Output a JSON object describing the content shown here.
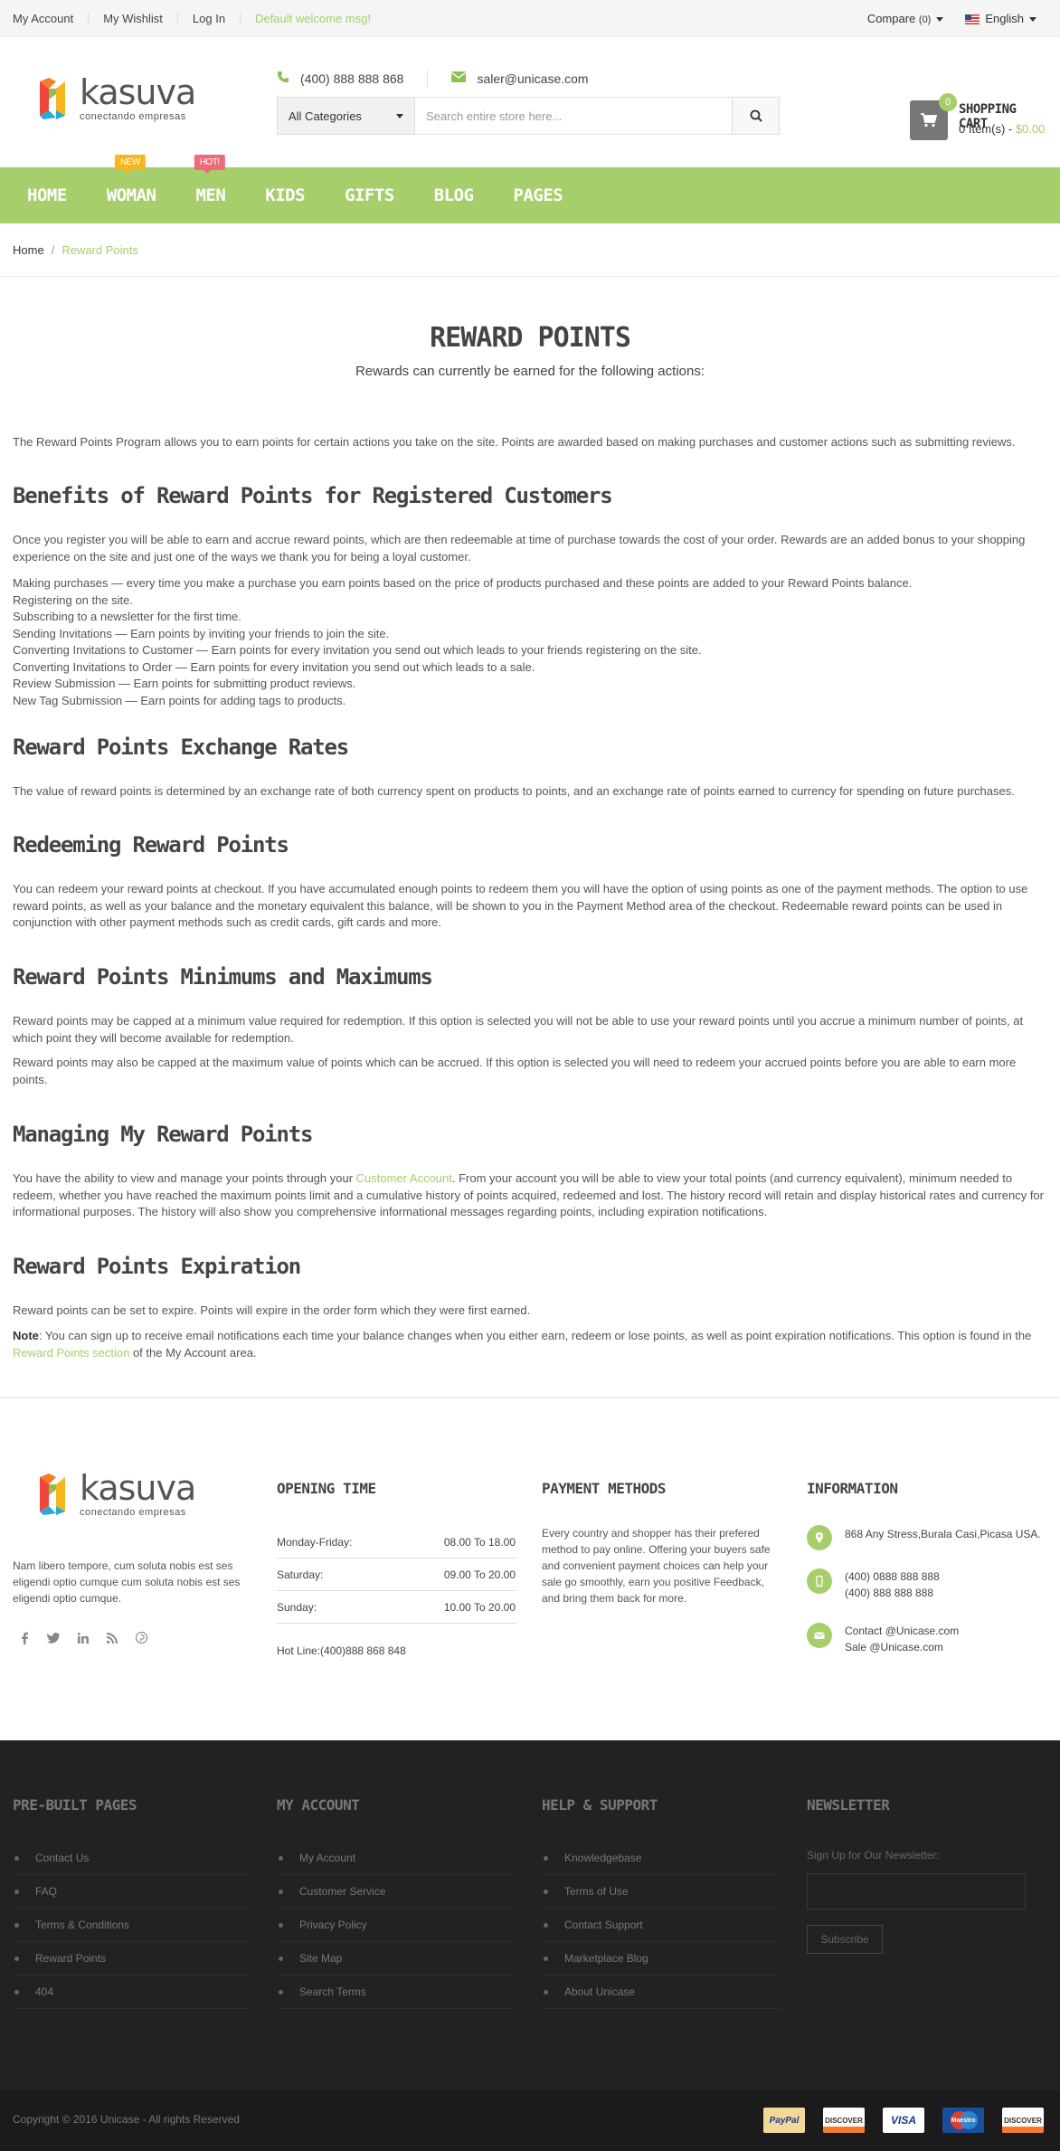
{
  "topbar": {
    "links": [
      "My Account",
      "My Wishlist",
      "Log In"
    ],
    "welcome": "Default welcome msg!",
    "compare": "Compare",
    "compare_count": "(0)",
    "language": "English"
  },
  "header": {
    "logo_word": "kasuva",
    "logo_tagline": "conectando empresas",
    "phone": "(400) 888 888 868",
    "email": "saler@unicase.com",
    "category_select": "All Categories",
    "search_placeholder": "Search entire store here...",
    "cart_count": "0",
    "cart_title": "SHOPPING CART",
    "cart_items": "0 Item(s) -",
    "cart_total": "$0.00"
  },
  "nav": {
    "items": [
      "HOME",
      "WOMAN",
      "MEN",
      "KIDS",
      "GIFTS",
      "BLOG",
      "PAGES"
    ],
    "badge_new": "NEW",
    "badge_hot": "HOT!"
  },
  "breadcrumb": {
    "home": "Home",
    "current": "Reward Points"
  },
  "main": {
    "title": "REWARD POINTS",
    "subtitle": "Rewards can currently be earned for the following actions:",
    "intro": "The Reward Points Program allows you to earn points for certain actions you take on the site. Points are awarded based on making purchases and customer actions such as submitting reviews.",
    "s1_title": "Benefits of Reward Points for Registered Customers",
    "s1_p": "Once you register you will be able to earn and accrue reward points, which are then redeemable at time of purchase towards the cost of your order. Rewards are an added bonus to your shopping experience on the site and just one of the ways we thank you for being a loyal customer.",
    "s1_list": [
      "Making purchases — every time you make a purchase you earn points based on the price of products purchased and these points are added to your Reward Points balance.",
      "Registering on the site.",
      "Subscribing to a newsletter for the first time.",
      "Sending Invitations — Earn points by inviting your friends to join the site.",
      "Converting Invitations to Customer — Earn points for every invitation you send out which leads to your friends registering on the site.",
      "Converting Invitations to Order — Earn points for every invitation you send out which leads to a sale.",
      "Review Submission — Earn points for submitting product reviews.",
      "New Tag Submission — Earn points for adding tags to products."
    ],
    "s2_title": "Reward Points Exchange Rates",
    "s2_p": "The value of reward points is determined by an exchange rate of both currency spent on products to points, and an exchange rate of points earned to currency for spending on future purchases.",
    "s3_title": "Redeeming Reward Points",
    "s3_p": "You can redeem your reward points at checkout. If you have accumulated enough points to redeem them you will have the option of using points as one of the payment methods. The option to use reward points, as well as your balance and the monetary equivalent this balance, will be shown to you in the Payment Method area of the checkout. Redeemable reward points can be used in conjunction with other payment methods such as credit cards, gift cards and more.",
    "s4_title": "Reward Points Minimums and Maximums",
    "s4_p1": "Reward points may be capped at a minimum value required for redemption. If this option is selected you will not be able to use your reward points until you accrue a minimum number of points, at which point they will become available for redemption.",
    "s4_p2": "Reward points may also be capped at the maximum value of points which can be accrued. If this option is selected you will need to redeem your accrued points before you are able to earn more points.",
    "s5_title": "Managing My Reward Points",
    "s5_pre": "You have the ability to view and manage your points through your ",
    "s5_link": "Customer Account",
    "s5_post": ". From your account you will be able to view your total points (and currency equivalent), minimum needed to redeem, whether you have reached the maximum points limit and a cumulative history of points acquired, redeemed and lost. The history record will retain and display historical rates and currency for informational purposes. The history will also show you comprehensive informational messages regarding points, including expiration notifications.",
    "s6_title": "Reward Points Expiration",
    "s6_p": "Reward points can be set to expire. Points will expire in the order form which they were first earned.",
    "note_label": "Note",
    "note_pre": ": You can sign up to receive email notifications each time your balance changes when you either earn, redeem or lose points, as well as point expiration notifications. This option is found in the ",
    "note_link": "Reward Points section",
    "note_post": " of the My Account area."
  },
  "footer": {
    "about": "Nam libero tempore, cum soluta nobis est ses eligendi optio cumque cum soluta nobis est ses eligendi optio cumque.",
    "social_icons": [
      "facebook-icon",
      "twitter-icon",
      "linkedin-icon",
      "rss-icon",
      "pinterest-icon"
    ],
    "opening_title": "OPENING TIME",
    "hours": [
      {
        "day": "Monday-Friday:",
        "time": "08.00 To 18.00"
      },
      {
        "day": "Saturday:",
        "time": "09.00 To 20.00"
      },
      {
        "day": "Sunday:",
        "time": "10.00 To 20.00"
      }
    ],
    "hotline": "Hot Line:(400)888 868 848",
    "payment_title": "PAYMENT METHODS",
    "payment_text": "Every country and shopper has their prefered method to pay online. Offering your buyers safe and convenient payment choices can help your sale go smoothly, earn you positive Feedback, and bring them back for more.",
    "info_title": "INFORMATION",
    "address": "868 Any Stress,Burala Casi,Picasa USA.",
    "phone1": "(400) 0888 888 888",
    "phone2": "(400) 888 888 888",
    "contact_email": "Contact @Unicase.com",
    "sale_email": "Sale @Unicase.com"
  },
  "footer_dark": {
    "col1_title": "PRE-BUILT PAGES",
    "col1": [
      "Contact Us",
      "FAQ",
      "Terms & Conditions",
      "Reward Points",
      "404"
    ],
    "col2_title": "MY ACCOUNT",
    "col2": [
      "My Account",
      "Customer Service",
      "Privacy Policy",
      "Site Map",
      "Search Terms"
    ],
    "col3_title": "HELP & SUPPORT",
    "col3": [
      "Knowledgebase",
      "Terms of Use",
      "Contact Support",
      "Marketplace Blog",
      "About Unicase"
    ],
    "newsletter_title": "NEWSLETTER",
    "newsletter_label": "Sign Up for Our Newsletter:",
    "subscribe": "Subscribe",
    "copyright": "Copyright © 2016 Unicase - All rights Reserved",
    "payments": [
      "PayPal",
      "DISCOVER",
      "VISA",
      "Maestro",
      "DISCOVER"
    ]
  },
  "colors": {
    "accent": "#a6ce6a",
    "dark": "#222222",
    "badge_new": "#f5b71d",
    "badge_hot": "#ef6b7a"
  }
}
